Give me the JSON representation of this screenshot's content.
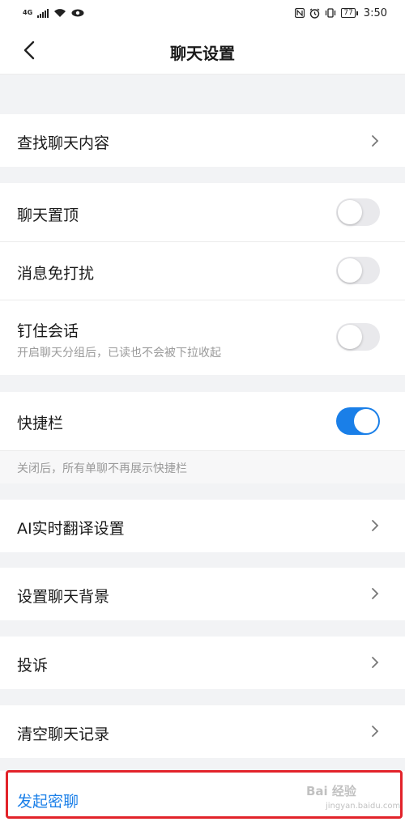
{
  "status_bar": {
    "network": "4G",
    "battery": "77",
    "time": "3:50"
  },
  "nav": {
    "title": "聊天设置"
  },
  "rows": {
    "search_history": "查找聊天内容",
    "pin_chat": "聊天置顶",
    "mute": "消息免打扰",
    "pin_session": "钉住会话",
    "pin_session_sub": "开启聊天分组后，已读也不会被下拉收起",
    "shortcut_bar": "快捷栏",
    "shortcut_bar_hint": "关闭后，所有单聊不再展示快捷栏",
    "ai_translate": "AI实时翻译设置",
    "chat_background": "设置聊天背景",
    "complaint": "投诉",
    "clear_history": "清空聊天记录",
    "secret_chat": "发起密聊"
  },
  "toggles": {
    "pin_chat": false,
    "mute": false,
    "pin_session": false,
    "shortcut_bar": true
  },
  "watermark": {
    "text": "Bai 经验",
    "sub": "jingyan.baidu.com"
  },
  "colors": {
    "accent": "#1a7fe8",
    "highlight_box": "#e2232a"
  }
}
